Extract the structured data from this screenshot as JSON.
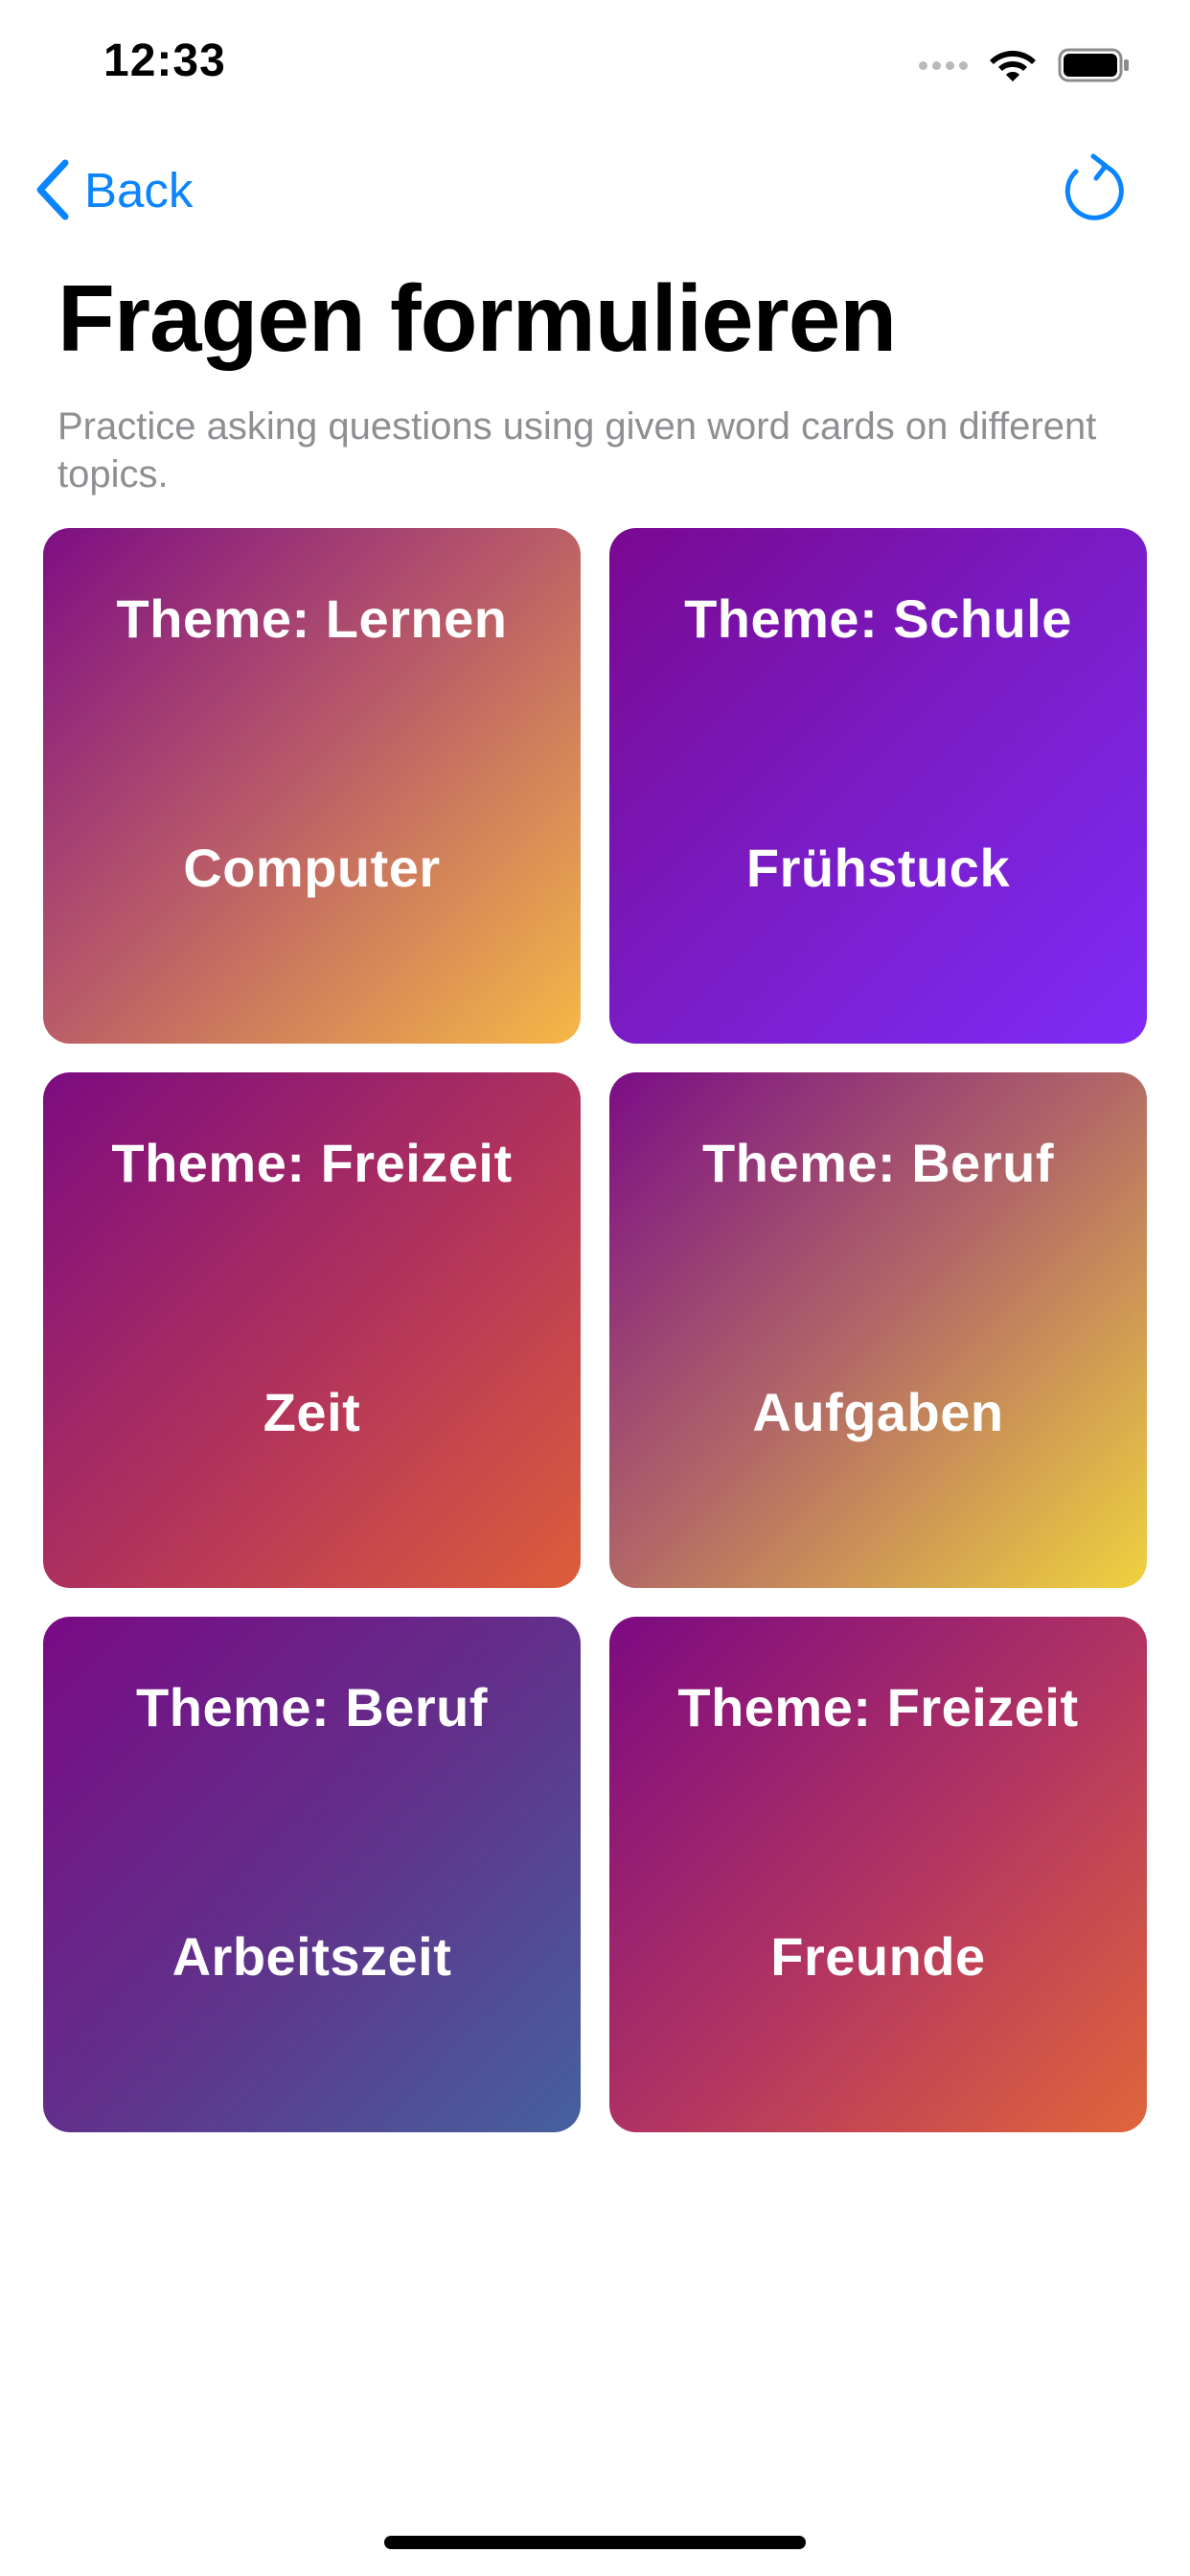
{
  "status_bar": {
    "time": "12:33",
    "icons": [
      "cellular-signal-icon",
      "wifi-icon",
      "battery-icon"
    ]
  },
  "nav": {
    "back_label": "Back",
    "back_icon": "chevron-left-icon",
    "refresh_icon": "refresh-icon",
    "accent_color": "#0A84FF"
  },
  "header": {
    "title": "Fragen formulieren",
    "subtitle": "Practice asking questions using given word cards on different topics."
  },
  "cards": [
    {
      "theme": "Theme: Lernen",
      "word": "Computer",
      "gradient": [
        "#7D0E84",
        "#F7B846"
      ]
    },
    {
      "theme": "Theme: Schule",
      "word": "Frühstuck",
      "gradient": [
        "#7A0890",
        "#7F2BF8"
      ]
    },
    {
      "theme": "Theme: Freizeit",
      "word": "Zeit",
      "gradient": [
        "#7C0C80",
        "#DC5E3A"
      ]
    },
    {
      "theme": "Theme: Beruf",
      "word": "Aufgaben",
      "gradient": [
        "#7B0D86",
        "#F0D23E"
      ]
    },
    {
      "theme": "Theme: Beruf",
      "word": "Arbeitszeit",
      "gradient": [
        "#7A0A86",
        "#45619E"
      ]
    },
    {
      "theme": "Theme: Freizeit",
      "word": "Freunde",
      "gradient": [
        "#7C0A82",
        "#E0663A"
      ]
    }
  ]
}
